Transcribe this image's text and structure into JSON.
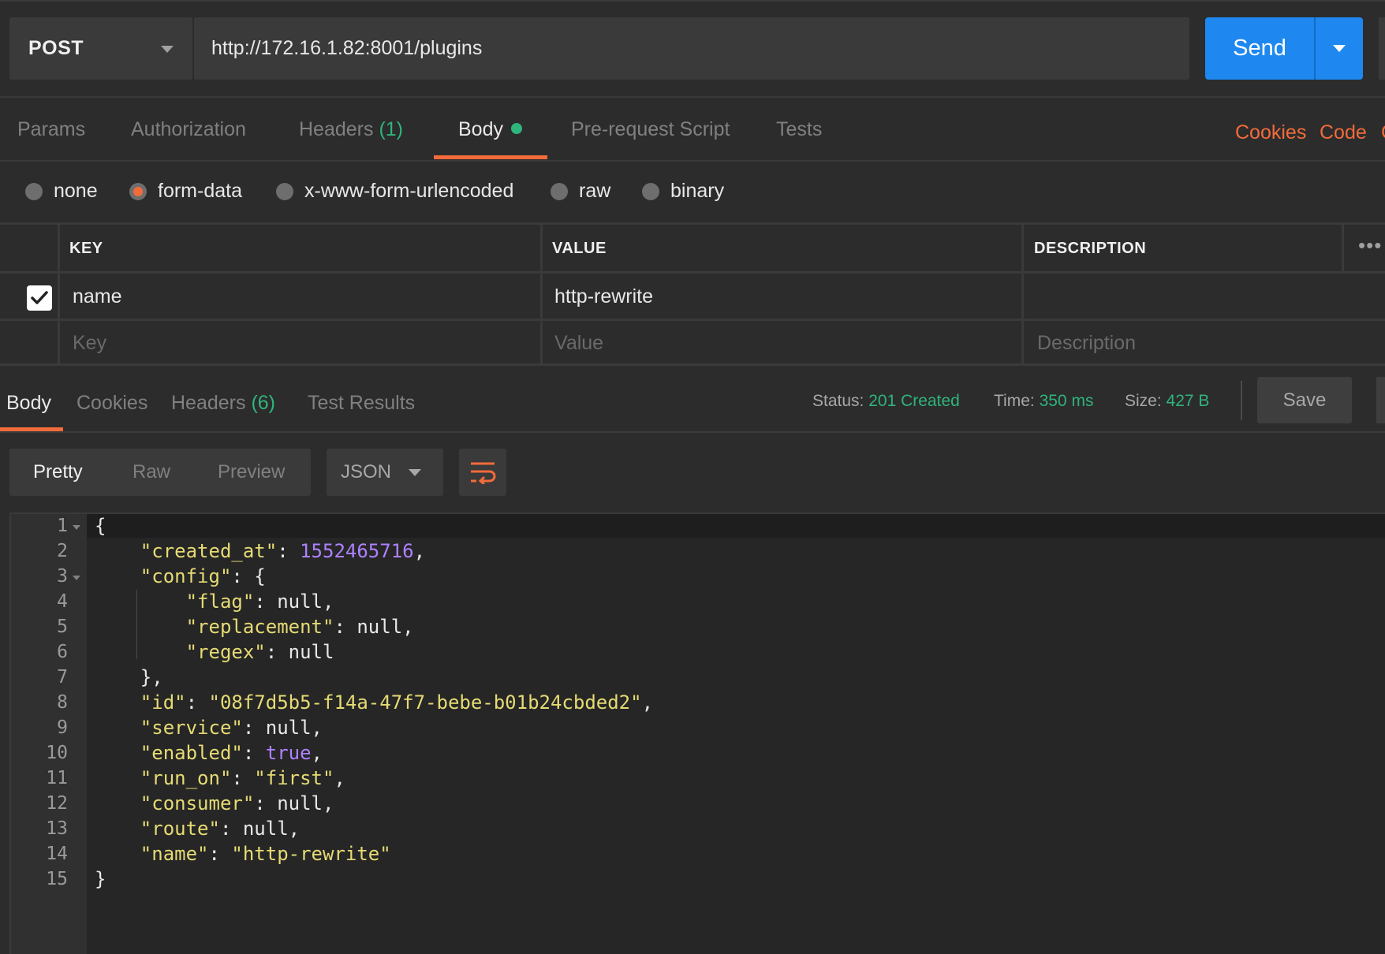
{
  "request": {
    "method": "POST",
    "url": "http://172.16.1.82:8001/plugins",
    "send_label": "Send"
  },
  "request_tabs": {
    "params": "Params",
    "authorization": "Authorization",
    "headers": "Headers",
    "headers_count": "(1)",
    "body": "Body",
    "pre_request": "Pre-request Script",
    "tests": "Tests",
    "cookies": "Cookies",
    "code": "Code"
  },
  "body_types": [
    "none",
    "form-data",
    "x-www-form-urlencoded",
    "raw",
    "binary"
  ],
  "body_type_selected": "form-data",
  "form_table": {
    "headers": [
      "KEY",
      "VALUE",
      "DESCRIPTION"
    ],
    "rows": [
      {
        "checked": true,
        "key": "name",
        "value": "http-rewrite",
        "description": ""
      }
    ],
    "placeholders": {
      "key": "Key",
      "value": "Value",
      "description": "Description"
    }
  },
  "response_tabs": {
    "body": "Body",
    "cookies": "Cookies",
    "headers": "Headers",
    "headers_count": "(6)",
    "test_results": "Test Results"
  },
  "response_status": {
    "status_label": "Status:",
    "status": "201 Created",
    "time_label": "Time:",
    "time": "350 ms",
    "size_label": "Size:",
    "size": "427 B",
    "save_label": "Save"
  },
  "view_modes": [
    "Pretty",
    "Raw",
    "Preview"
  ],
  "view_mode_selected": "Pretty",
  "format": "JSON",
  "line_numbers": [
    "1",
    "2",
    "3",
    "4",
    "5",
    "6",
    "7",
    "8",
    "9",
    "10",
    "11",
    "12",
    "13",
    "14",
    "15"
  ],
  "response_json": {
    "created_at": "1552465716",
    "id": "08f7d5b5-f14a-47f7-bebe-b01b24cbded2",
    "enabled": "true",
    "run_on": "first",
    "name": "http-rewrite",
    "null": "null"
  },
  "colors": {
    "accent": "#f26b3a",
    "send": "#1e88f0",
    "success": "#2fb47c",
    "json_string": "#e6db74",
    "json_number": "#ae81ff"
  }
}
